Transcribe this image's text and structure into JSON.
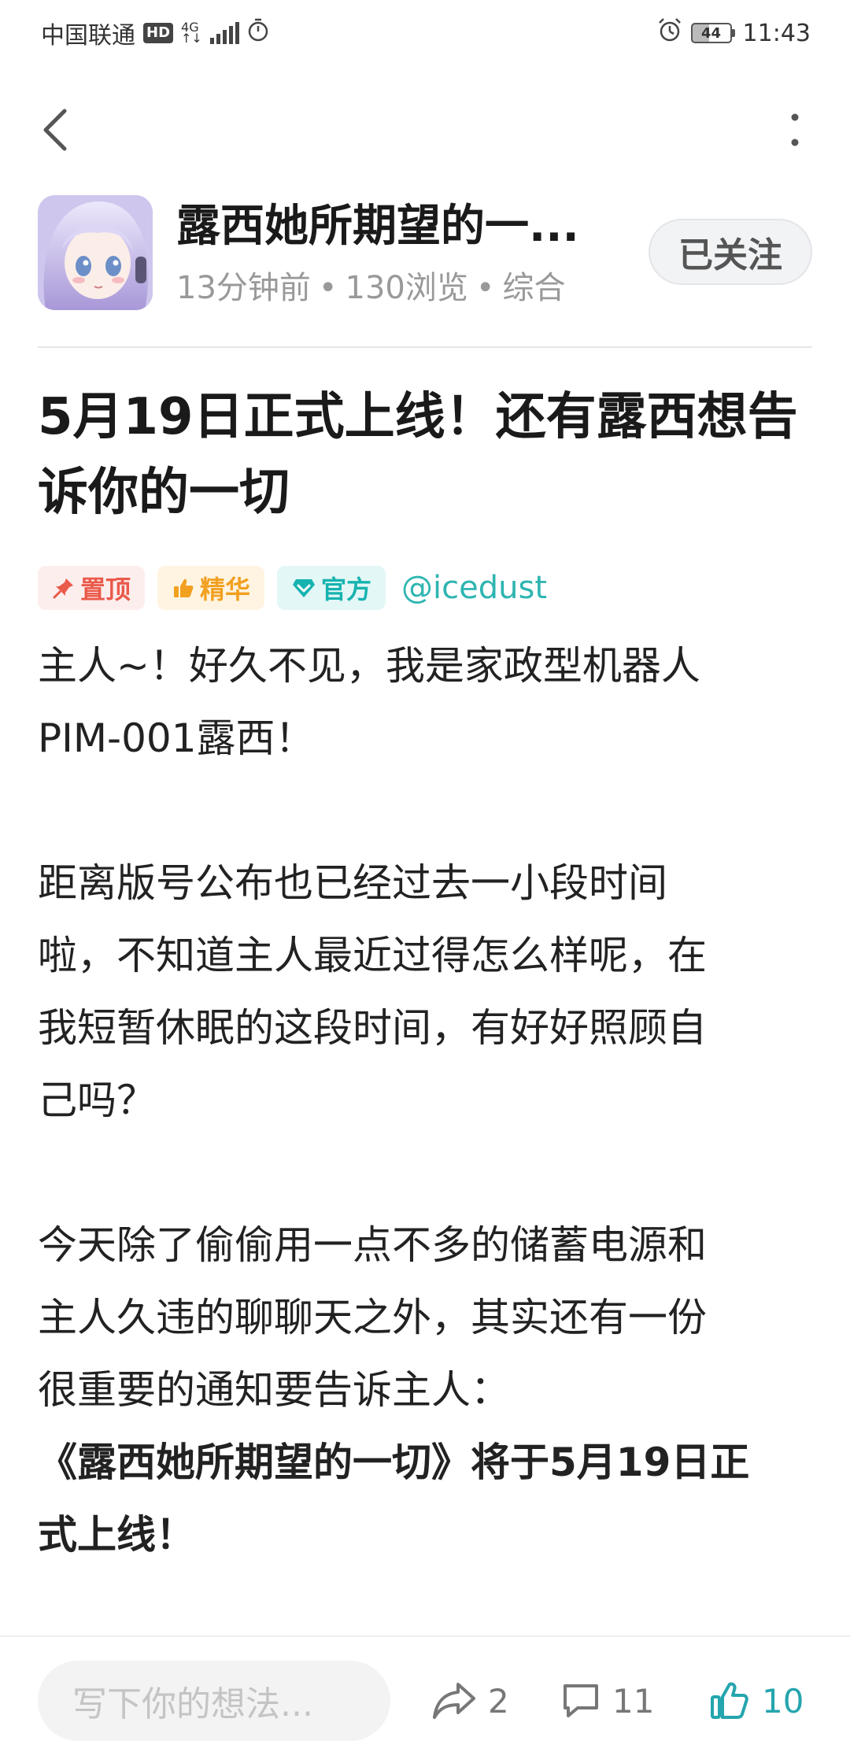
{
  "status_bar": {
    "carrier": "中国联通",
    "hd": "HD",
    "network_top": "4G",
    "network_bottom": "↑↓",
    "battery": "44",
    "time": "11:43"
  },
  "nav": {
    "back_icon": "chevron-left-icon",
    "more_icon": "more-vertical-icon"
  },
  "author": {
    "name": "露西她所期望的一...",
    "time_ago": "13分钟前",
    "views": "130浏览",
    "category": "综合",
    "separator": "•",
    "follow_label": "已关注"
  },
  "article": {
    "title": "5月19日正式上线！还有露西想告诉你的一切",
    "tags": [
      {
        "label": "置顶",
        "icon": "pin-icon",
        "color": "#ea5a4a"
      },
      {
        "label": "精华",
        "icon": "thumbs-up-icon",
        "color": "#f2a020"
      },
      {
        "label": "官方",
        "icon": "diamond-icon",
        "color": "#16b3b0"
      }
    ],
    "mention": "@icedust",
    "paragraphs": [
      "主人~！好久不见，我是家政型机器人",
      "PIM-001露西！",
      "距离版号公布也已经过去一小段时间",
      "啦，不知道主人最近过得怎么样呢，在",
      "我短暂休眠的这段时间，有好好照顾自",
      "己吗？",
      "今天除了偷偷用一点不多的储蓄电源和",
      "主人久违的聊聊天之外，其实还有一份",
      "很重要的通知要告诉主人：",
      "《露西她所期望的一切》将于5月19日正",
      "式上线！"
    ]
  },
  "bottom_bar": {
    "comment_placeholder": "写下你的想法...",
    "share_count": "2",
    "comment_count": "11",
    "like_count": "10",
    "accent_color": "#25a5ae"
  }
}
